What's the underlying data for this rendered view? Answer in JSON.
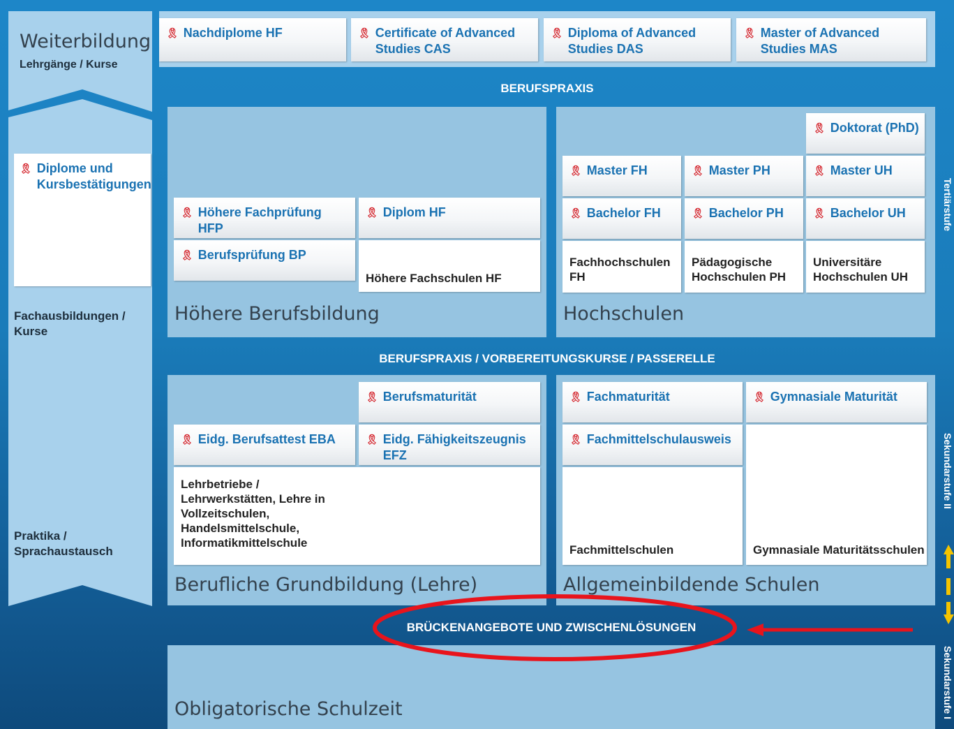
{
  "weiterbildung": {
    "title": "Weiterbildung",
    "subtitle": "Lehrgänge / Kurse",
    "items": [
      "Nachdiplome HF",
      "Certificate of Advanced Studies CAS",
      "Diploma of Advanced Studies DAS",
      "Master of Advanced Studies MAS"
    ]
  },
  "left_column": {
    "box_label": "Diplome und Kursbestätigungen",
    "fachausbildungen": "Fachausbildungen / Kurse",
    "praktika": "Praktika / Sprachaustausch"
  },
  "berufspraxis_top": "BERUFSPRAXIS",
  "hoehere_berufsbildung": {
    "title": "Höhere Berufsbildung",
    "hfp": "Höhere Fachprüfung HFP",
    "bp": "Berufsprüfung BP",
    "diplom_hf": "Diplom HF",
    "hf_schools": "Höhere Fachschulen HF"
  },
  "hochschulen": {
    "title": "Hochschulen",
    "doktorat": "Doktorat (PhD)",
    "master_fh": "Master FH",
    "master_ph": "Master PH",
    "master_uh": "Master UH",
    "bachelor_fh": "Bachelor FH",
    "bachelor_ph": "Bachelor PH",
    "bachelor_uh": "Bachelor UH",
    "fh_school": "Fachhochschulen FH",
    "ph_school": "Pädagogische Hochschulen PH",
    "uh_school": "Universitäre Hochschulen UH"
  },
  "mid_band": "BERUFSPRAXIS / VORBEREITUNGSKURSE / PASSERELLE",
  "grundbildung": {
    "title": "Berufliche Grundbildung (Lehre)",
    "berufsmaturitaet": "Berufsmaturität",
    "eba": "Eidg. Berufsattest EBA",
    "efz": "Eidg. Fähigkeitszeugnis EFZ",
    "schools": "Lehrbetriebe / Lehrwerkstätten, Lehre in Vollzeitschulen, Handelsmittelschule, Informatikmittelschule"
  },
  "allgemeinbildende": {
    "title": "Allgemeinbildende Schulen",
    "fachmaturitaet": "Fachmaturität",
    "gym_maturitaet": "Gymnasiale Maturität",
    "fms_ausweis": "Fachmittelschulausweis",
    "fms_school": "Fachmittelschulen",
    "gym_school": "Gymnasiale Maturitätsschulen"
  },
  "bridge_band": "BRÜCKENANGEBOTE UND ZWISCHENLÖSUNGEN",
  "obligatorisch": "Obligatorische Schulzeit",
  "vertical_labels": [
    "Tertiärstufe",
    "Sekundarstufe II",
    "Sekundarstufe I"
  ],
  "colors": {
    "accent_blue": "#1a72b2",
    "ribbon_red": "#d4242c",
    "highlight_red": "#e8141c",
    "arrow_yellow": "#f5c400"
  }
}
